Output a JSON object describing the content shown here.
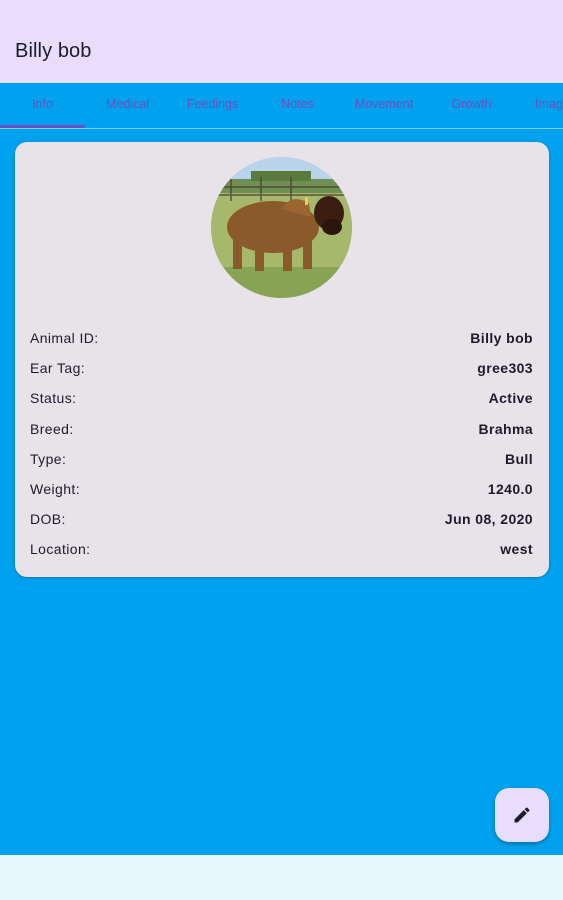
{
  "app_bar": {
    "title": "Billy bob"
  },
  "tabs": [
    {
      "label": "Info",
      "selected": true
    },
    {
      "label": "Medical",
      "selected": false
    },
    {
      "label": "Feedings",
      "selected": false
    },
    {
      "label": "Notes",
      "selected": false
    },
    {
      "label": "Movement",
      "selected": false
    },
    {
      "label": "Growth",
      "selected": false
    },
    {
      "label": "Imag",
      "selected": false
    }
  ],
  "animal": {
    "photo_icon": "bull-photo",
    "fields": [
      {
        "label": "Animal ID:",
        "value": "Billy bob"
      },
      {
        "label": "Ear Tag:",
        "value": "gree303"
      },
      {
        "label": "Status:",
        "value": "Active"
      },
      {
        "label": "Breed:",
        "value": "Brahma"
      },
      {
        "label": "Type:",
        "value": "Bull"
      },
      {
        "label": "Weight:",
        "value": "1240.0"
      },
      {
        "label": "DOB:",
        "value": "Jun 08, 2020"
      },
      {
        "label": "Location:",
        "value": "west"
      }
    ]
  },
  "fab": {
    "icon": "pencil-edit-icon"
  },
  "colors": {
    "app_bar": "#e9ddfe",
    "content_bg": "#00a2ef",
    "tab_text": "#6b4fbf",
    "card_bg": "#e8e2e9",
    "bottom_bar": "#e8f7fe"
  }
}
